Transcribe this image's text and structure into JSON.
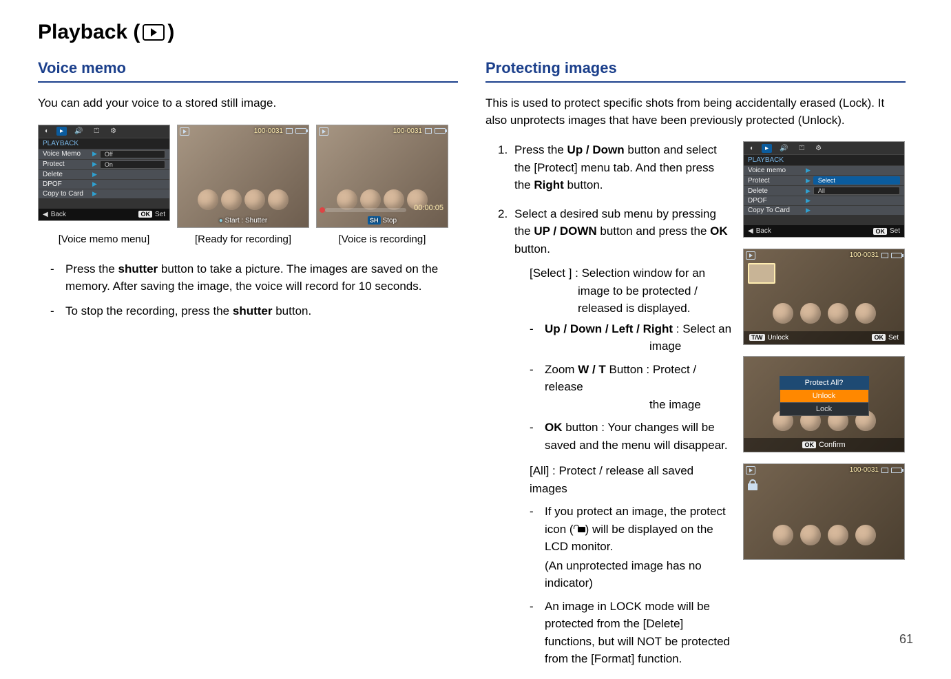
{
  "page": {
    "title_prefix": "Playback (",
    "title_suffix": ")",
    "number": "61"
  },
  "left": {
    "section": "Voice memo",
    "intro": "You can add your voice to a stored still image.",
    "menu": {
      "header": "PLAYBACK",
      "rows": [
        {
          "label": "Voice Memo",
          "value": "Off"
        },
        {
          "label": "Protect",
          "value": "On"
        },
        {
          "label": "Delete",
          "value": ""
        },
        {
          "label": "DPOF",
          "value": ""
        },
        {
          "label": "Copy to Card",
          "value": ""
        }
      ],
      "footer_back": "Back",
      "footer_ok": "OK",
      "footer_set": "Set"
    },
    "photo1": {
      "file": "100-0031",
      "bottom": "Start : Shutter"
    },
    "photo2": {
      "file": "100-0031",
      "time": "00:00:05",
      "sh": "SH",
      "stop": "Stop"
    },
    "captions": [
      "[Voice memo menu]",
      "[Ready for recording]",
      "[Voice is recording]"
    ],
    "bullets": [
      "Press the <b>shutter</b> button to take a picture. The images are saved on the memory. After saving the image, the voice will record for 10 seconds.",
      "To stop the recording, press the <b>shutter</b> button."
    ]
  },
  "right": {
    "section": "Protecting images",
    "intro": "This is used to protect specific shots from being accidentally erased (Lock). It also unprotects images that have been previously protected (Unlock).",
    "steps": [
      "Press the <b>Up / Down</b> button and select the [Protect] menu tab. And then press the <b>Right</b> button.",
      "Select a desired sub menu by pressing the <b>UP / DOWN</b> button and press the <b>OK</b> button."
    ],
    "select_label": "[Select ] : Selection window for an image to be protected / released is displayed.",
    "select_bullets": [
      "<b>Up / Down / Left / Right</b> : Select an",
      "Zoom <b>W / T</b> Button : Protect / release",
      "<b>OK</b> button : Your changes will be saved and the menu will disappear."
    ],
    "select_b1_tail": "image",
    "select_b2_tail": "the image",
    "all_label": "[All] : Protect / release all saved images",
    "all_bullets": [
      "If you protect an image, the protect icon (      ) will be displayed on the LCD monitor.",
      "(An unprotected image has no indicator)",
      "An image in LOCK mode will be protected from the [Delete] functions, but will NOT be protected from the [Format] function."
    ],
    "menu2": {
      "header": "PLAYBACK",
      "rows": [
        {
          "label": "Voice memo",
          "value": ""
        },
        {
          "label": "Protect",
          "value": "Select",
          "highlight": true
        },
        {
          "label": "Delete",
          "value": "All"
        },
        {
          "label": "DPOF",
          "value": ""
        },
        {
          "label": "Copy To Card",
          "value": ""
        }
      ],
      "footer_back": "Back",
      "footer_ok": "OK",
      "footer_set": "Set"
    },
    "select_img": {
      "file": "100-0031",
      "tw": "T/W",
      "unlock": "Unlock",
      "ok": "OK",
      "set": "Set"
    },
    "protect_all": {
      "title": "Protect All?",
      "opt1": "Unlock",
      "opt2": "Lock",
      "ok": "OK",
      "confirm": "Confirm"
    },
    "locked_img": {
      "file": "100-0031"
    }
  }
}
